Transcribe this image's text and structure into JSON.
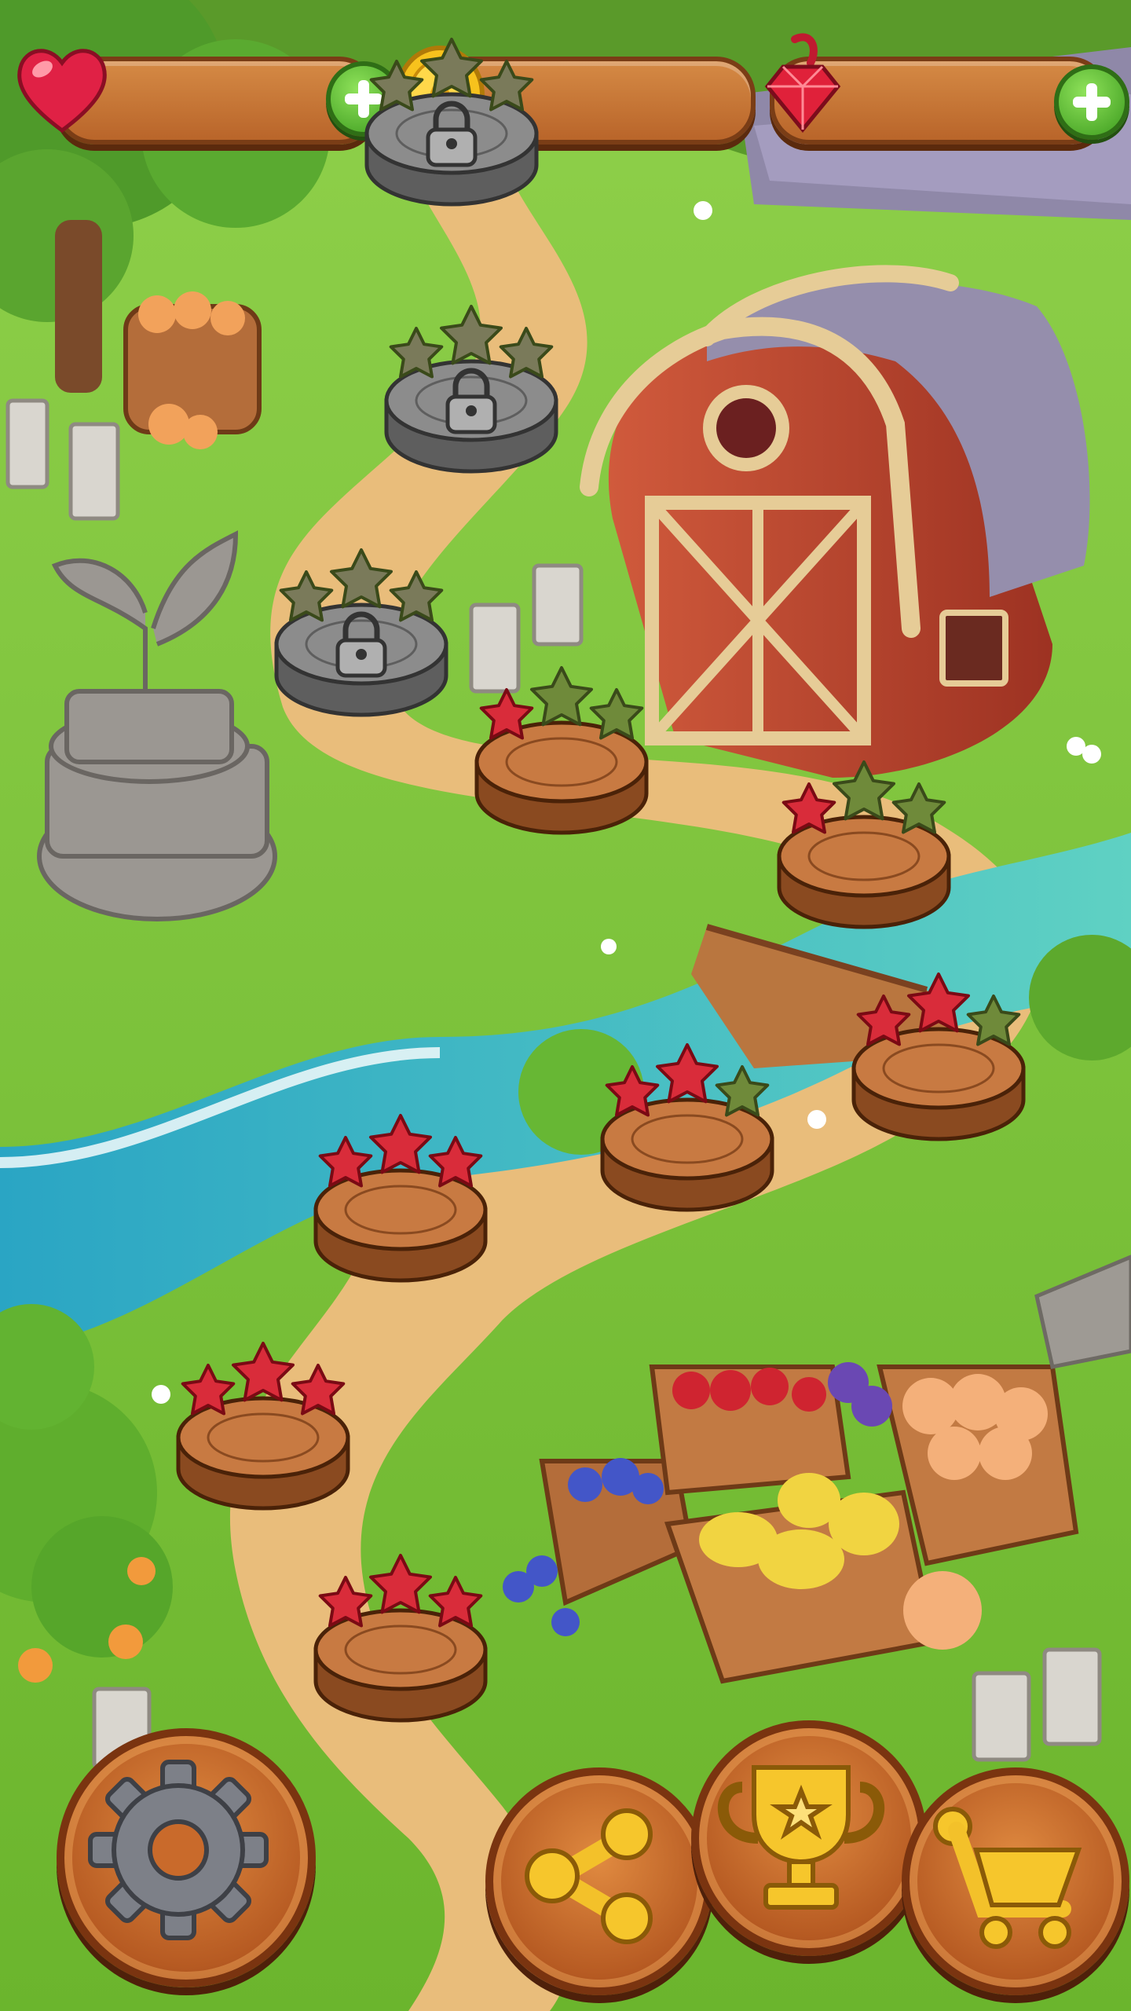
{
  "colors": {
    "grass": "#7cc33a",
    "path": "#e7b873",
    "river": "#3cb8c4",
    "wood": "#c06a2c",
    "star_earned": "#d92c3a",
    "star_empty": "#6f8a3a",
    "locked_stone": "#8a8a8a"
  },
  "hud": {
    "lives": {
      "icon": "heart-icon",
      "value": ""
    },
    "coins": {
      "icon": "coin-icon",
      "value": ""
    },
    "gems": {
      "icon": "ruby-icon",
      "value": ""
    }
  },
  "level_map": {
    "levels": [
      {
        "stars": 3,
        "state": "completed"
      },
      {
        "stars": 3,
        "state": "completed"
      },
      {
        "stars": 3,
        "state": "completed"
      },
      {
        "stars": 2,
        "state": "completed"
      },
      {
        "stars": 2,
        "state": "completed"
      },
      {
        "stars": 1,
        "state": "completed"
      },
      {
        "stars": 1,
        "state": "current"
      },
      {
        "stars": 0,
        "state": "locked"
      },
      {
        "stars": 0,
        "state": "locked"
      },
      {
        "stars": 0,
        "state": "locked"
      }
    ]
  },
  "bottom_bar": {
    "settings": {
      "icon": "gear-icon"
    },
    "share": {
      "icon": "share-icon"
    },
    "trophy": {
      "icon": "trophy-icon"
    },
    "shop": {
      "icon": "cart-icon"
    }
  }
}
